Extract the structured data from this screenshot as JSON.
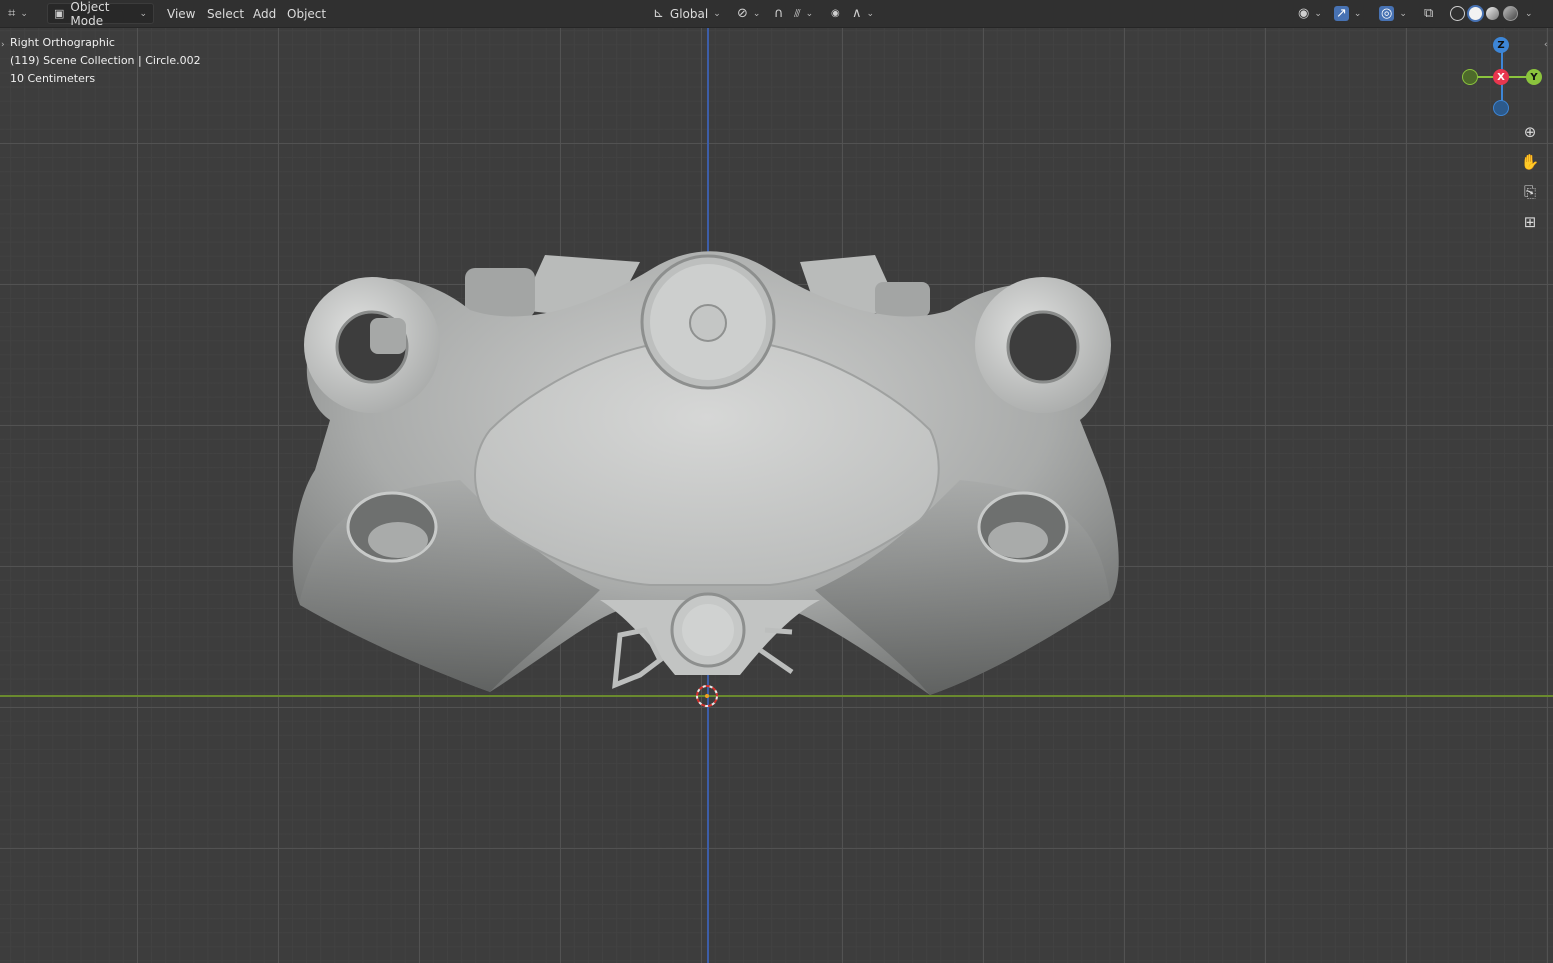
{
  "header": {
    "editor_type_icon": "3d-viewport-icon",
    "mode": "Object Mode",
    "menus": [
      "View",
      "Select",
      "Add",
      "Object"
    ],
    "transform_orientation": "Global",
    "pivot_icon": "pivot-point-icon",
    "snap_icon": "magnet-icon",
    "snap_target_icon": "snap-increment-icon",
    "proportional_icon": "proportional-edit-icon",
    "falloff_icon": "falloff-curve-icon"
  },
  "overlay_info": {
    "view_name": "Right Orthographic",
    "collection": "(119) Scene Collection | Circle.002",
    "scale": "10 Centimeters"
  },
  "gizmo": {
    "z_label": "Z",
    "x_label": "X",
    "y_label": "Y",
    "colors": {
      "x": "#e8364e",
      "y": "#8bc43d",
      "z": "#3d86d7"
    }
  },
  "nav_tools": [
    "zoom-icon",
    "pan-hand-icon",
    "camera-icon",
    "grid-icon"
  ],
  "colors": {
    "viewport_bg": "#3d3d3d",
    "header_bg": "#303030",
    "accent": "#4772b3"
  }
}
